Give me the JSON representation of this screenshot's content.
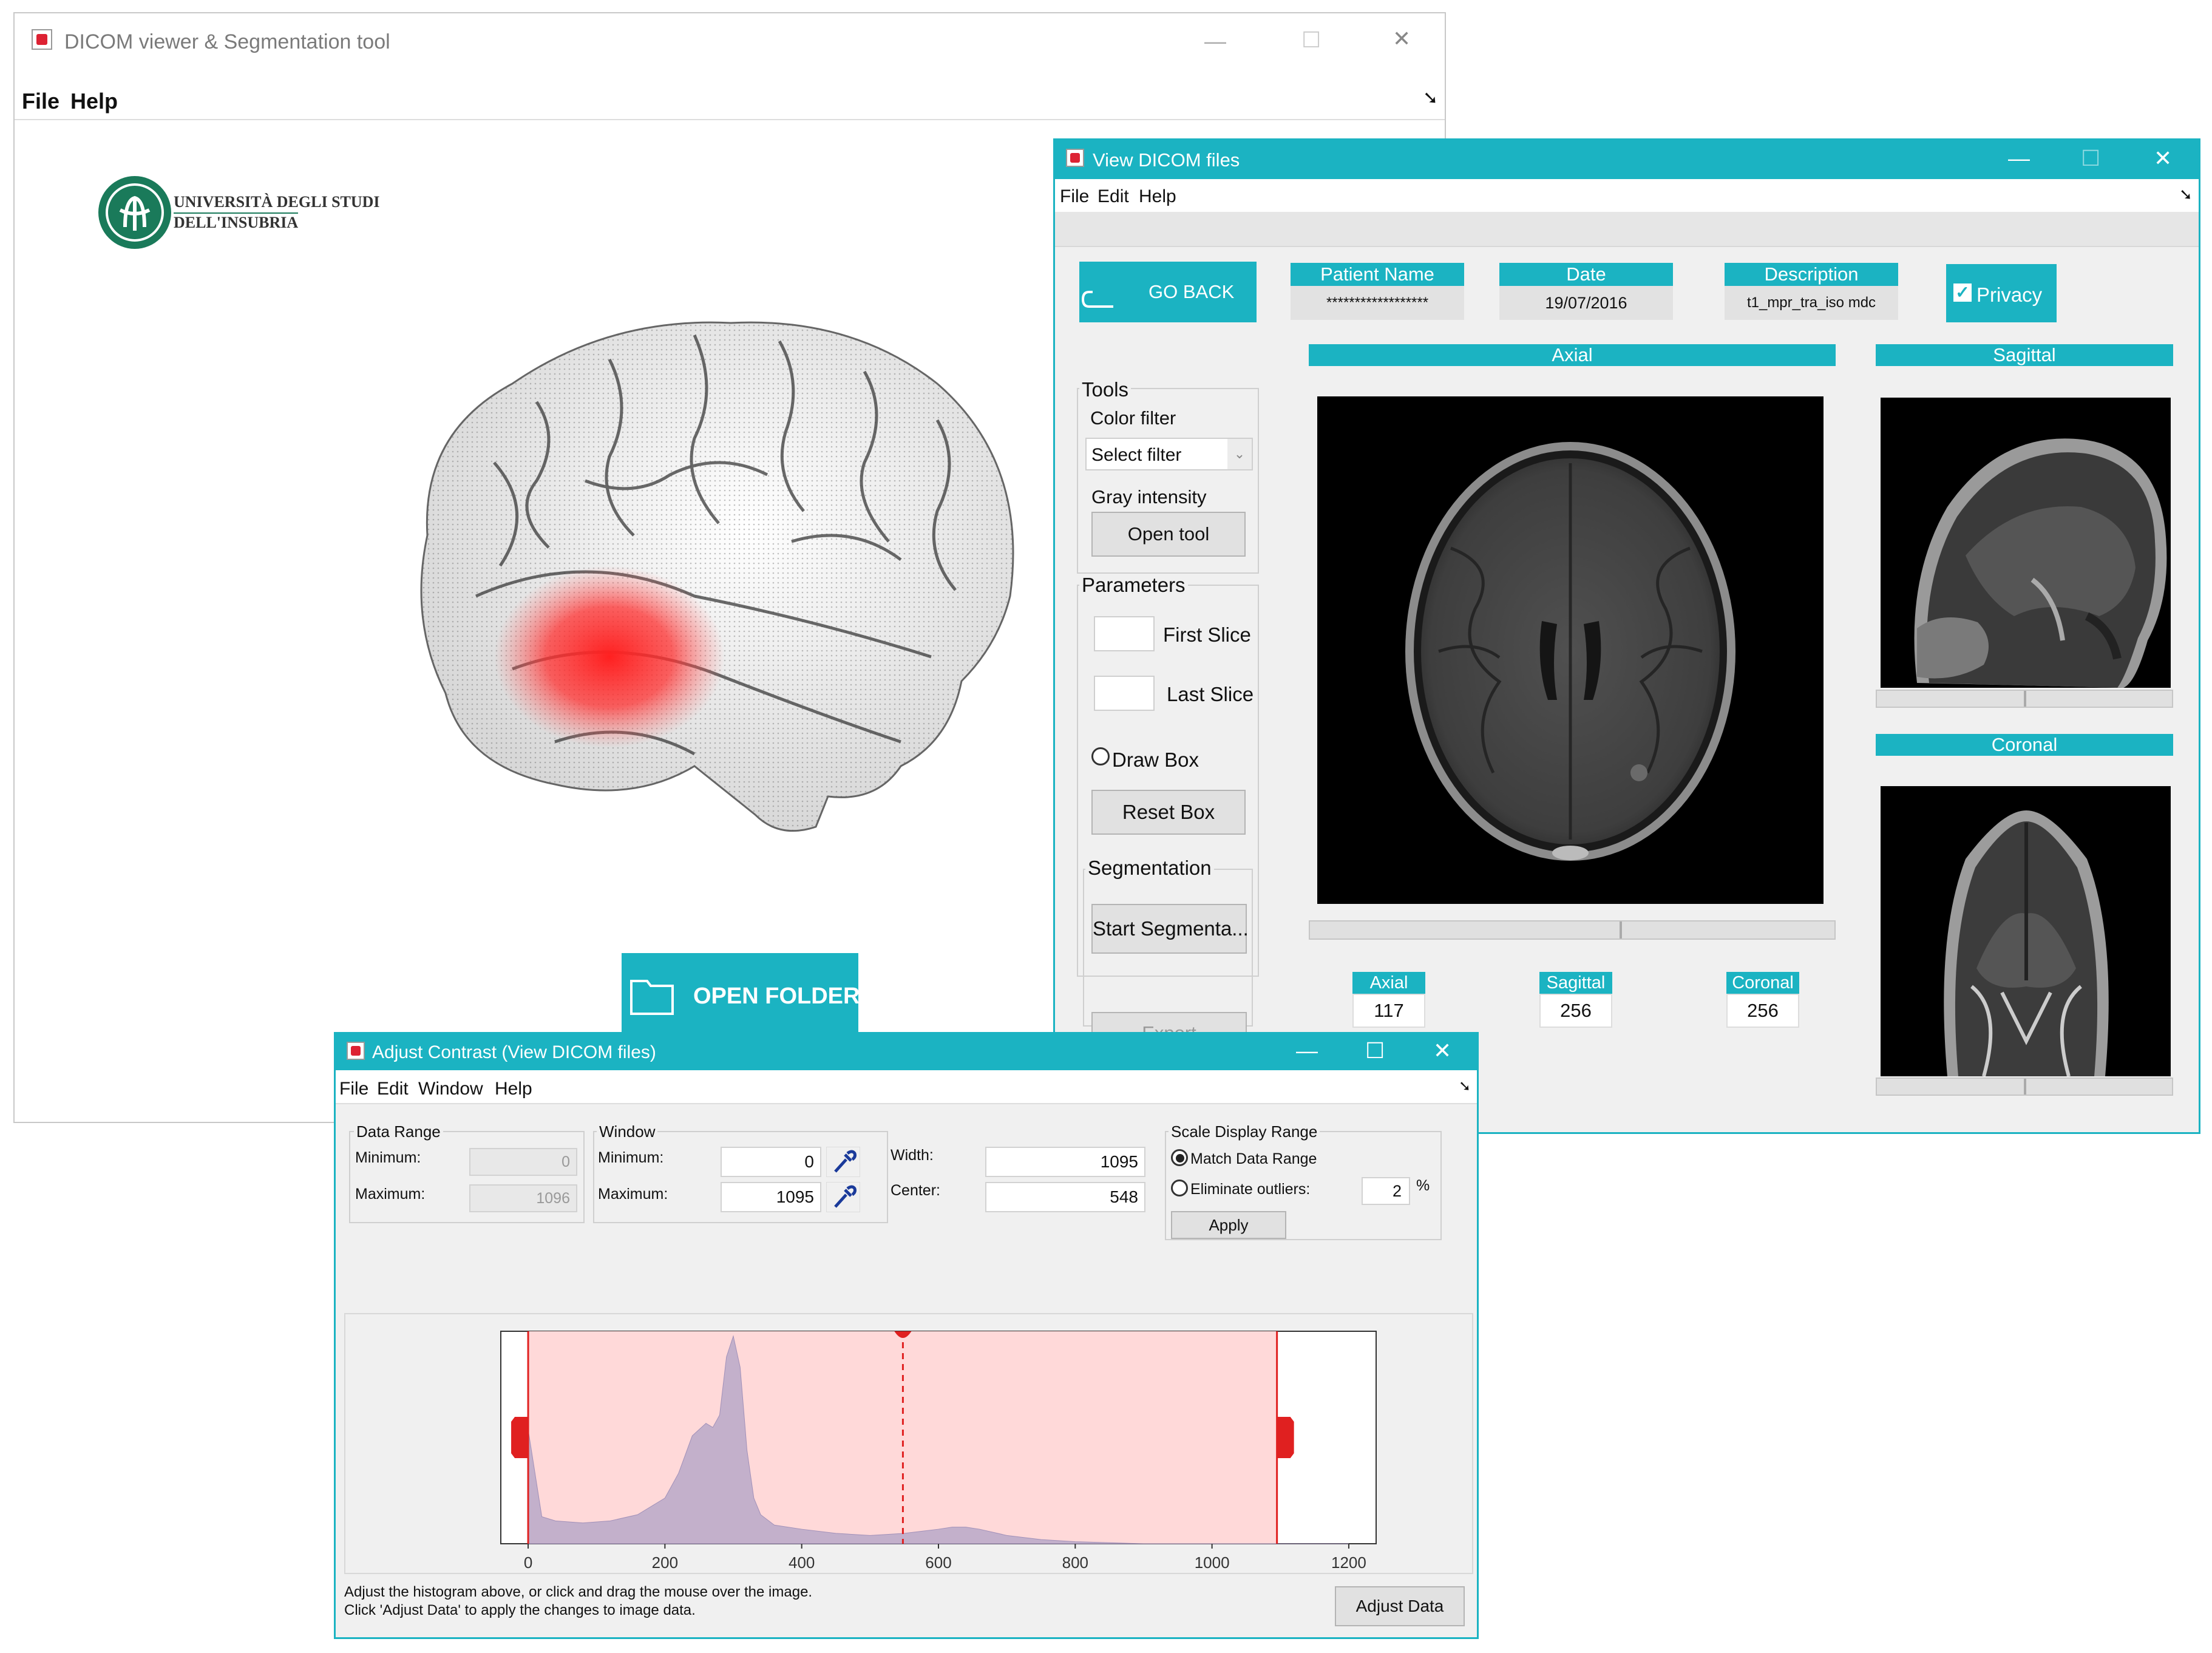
{
  "main_window": {
    "title": "DICOM viewer & Segmentation tool",
    "menu": [
      "File",
      "Help"
    ],
    "logo_text": [
      "UNIVERSITÀ DEGLI STUDI",
      "DELL'INSUBRIA"
    ],
    "open_folder_label": "OPEN FOLDER"
  },
  "viewer_window": {
    "title": "View DICOM files",
    "menu": [
      "File",
      "Edit",
      "Help"
    ],
    "go_back_label": "GO BACK",
    "patient_name_header": "Patient Name",
    "patient_name_value": "******************",
    "date_header": "Date",
    "date_value": "19/07/2016",
    "description_header": "Description",
    "description_value": "t1_mpr_tra_iso mdc",
    "privacy_label": "Privacy",
    "privacy_checked": true,
    "axial_header": "Axial",
    "sagittal_header": "Sagittal",
    "coronal_header": "Coronal",
    "tools_group": "Tools",
    "color_filter_label": "Color filter",
    "select_filter_value": "Select filter",
    "gray_intensity_label": "Gray intensity",
    "open_tool_label": "Open tool",
    "parameters_group": "Parameters",
    "first_slice_label": "First Slice",
    "last_slice_label": "Last Slice",
    "draw_box_label": "Draw Box",
    "reset_box_label": "Reset Box",
    "segmentation_group": "Segmentation",
    "start_segmentation_label": "Start Segmenta...",
    "export_label": "Export",
    "slice_axial_label": "Axial",
    "slice_axial_value": "117",
    "slice_sagittal_label": "Sagittal",
    "slice_sagittal_value": "256",
    "slice_coronal_label": "Coronal",
    "slice_coronal_value": "256"
  },
  "contrast_window": {
    "title": "Adjust Contrast (View DICOM files)",
    "menu": [
      "File",
      "Edit",
      "Window",
      "Help"
    ],
    "data_range_group": "Data Range",
    "minimum_label": "Minimum:",
    "maximum_label": "Maximum:",
    "data_min": "0",
    "data_max": "1096",
    "window_group": "Window",
    "window_min": "0",
    "window_max": "1095",
    "width_label": "Width:",
    "center_label": "Center:",
    "width_value": "1095",
    "center_value": "548",
    "scale_group": "Scale Display Range",
    "match_data_range_label": "Match Data Range",
    "eliminate_outliers_label": "Eliminate outliers:",
    "outliers_value": "2",
    "percent_label": "%",
    "apply_label": "Apply",
    "instructions_line1": "Adjust the histogram above, or click and drag the mouse over the image.",
    "instructions_line2": "Click 'Adjust Data' to apply the changes to image data.",
    "adjust_data_label": "Adjust Data"
  },
  "colors": {
    "accent": "#1bb3c2",
    "window_band": "#ffd9d9",
    "histogram": "#b8a8c8",
    "marker": "#e02020"
  },
  "chart_data": {
    "type": "area",
    "title": "",
    "xlabel": "",
    "ylabel": "",
    "xlim": [
      -40,
      1240
    ],
    "xticks": [
      0,
      200,
      400,
      600,
      800,
      1000,
      1200
    ],
    "x": [
      0,
      20,
      40,
      80,
      120,
      160,
      200,
      220,
      240,
      260,
      270,
      280,
      290,
      300,
      310,
      320,
      330,
      340,
      360,
      400,
      450,
      500,
      550,
      600,
      620,
      640,
      660,
      700,
      750,
      800,
      900,
      1000,
      1100,
      1200
    ],
    "values": [
      0.55,
      0.13,
      0.11,
      0.1,
      0.11,
      0.14,
      0.22,
      0.34,
      0.52,
      0.58,
      0.56,
      0.62,
      0.9,
      1.0,
      0.85,
      0.45,
      0.22,
      0.14,
      0.09,
      0.07,
      0.05,
      0.04,
      0.05,
      0.07,
      0.08,
      0.08,
      0.07,
      0.04,
      0.02,
      0.01,
      0.0,
      0.0,
      0.0,
      0.0
    ],
    "window_min": 0,
    "window_max": 1095,
    "window_center": 548
  }
}
